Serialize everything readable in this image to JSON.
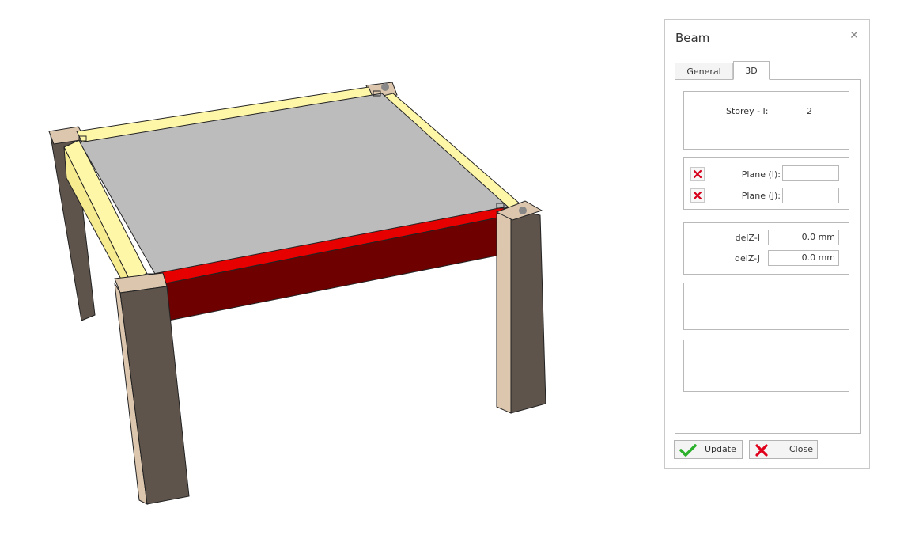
{
  "panel": {
    "title": "Beam",
    "tabs": [
      {
        "label": "General"
      },
      {
        "label": "3D"
      }
    ],
    "active_tab": "3D",
    "storey": {
      "label": "Storey - I:",
      "value": "2"
    },
    "plane_i": {
      "label": "Plane (I):",
      "value": ""
    },
    "plane_j": {
      "label": "Plane (J):",
      "value": ""
    },
    "delz_i": {
      "label": "delZ-I",
      "value": "0.0 mm"
    },
    "delz_j": {
      "label": "delZ-J",
      "value": "0.0 mm"
    },
    "buttons": {
      "update": "Update",
      "close": "Close"
    }
  },
  "colors": {
    "selected_beam": "#e60000",
    "beam_yellow": "#fff7a8",
    "slab": "#bcbcbc",
    "column_front": "#5e544c",
    "column_top": "#dcc6ae",
    "highlight": "#d01c1c"
  },
  "icons": [
    "close-icon",
    "delete-x-icon",
    "check-icon"
  ]
}
